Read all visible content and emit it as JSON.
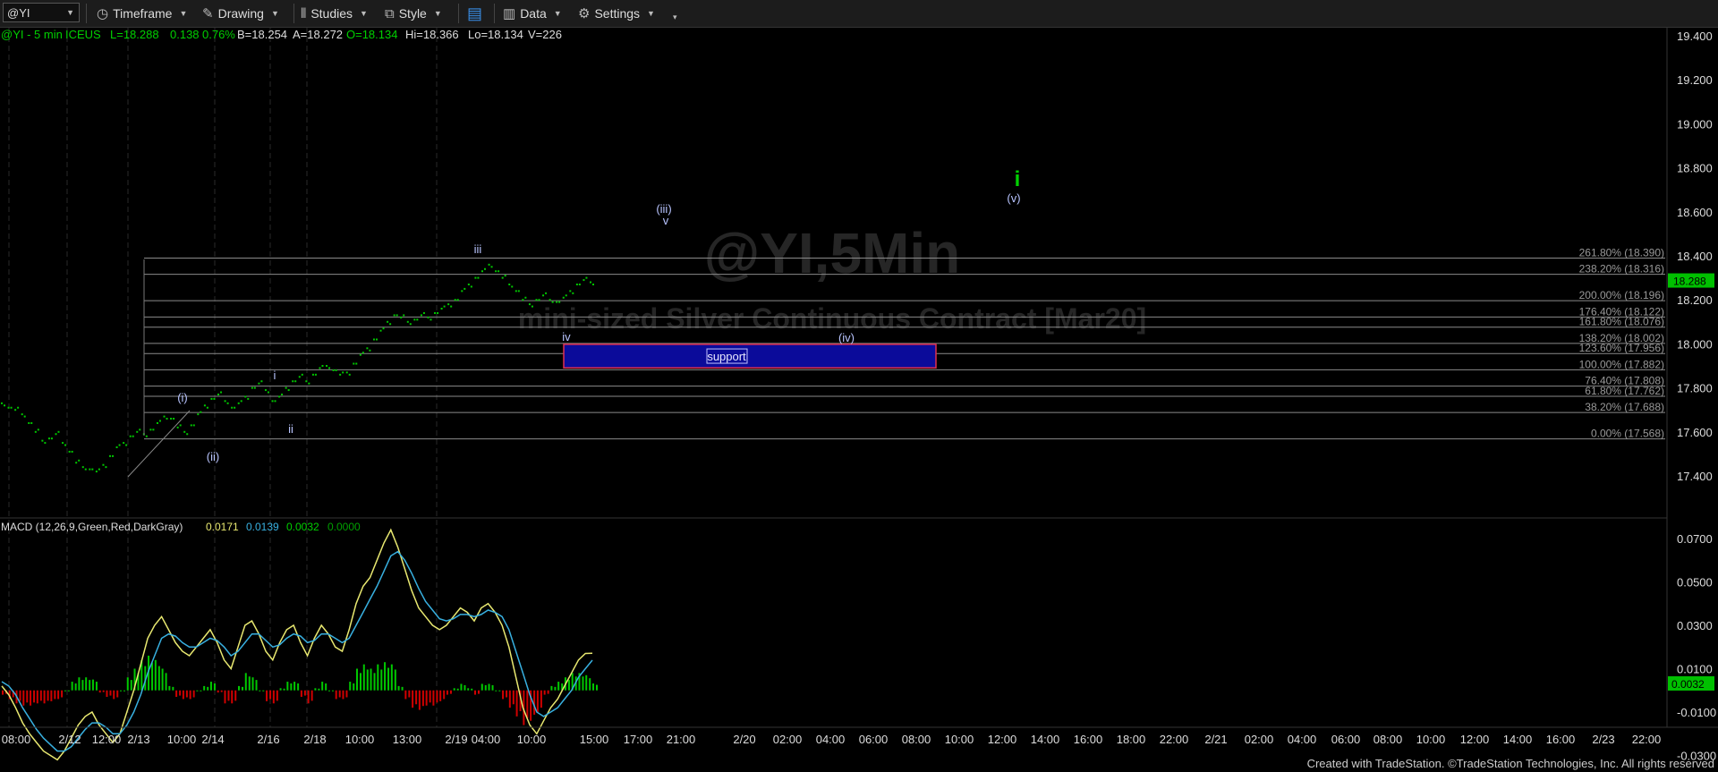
{
  "toolbar": {
    "symbol": "@YI",
    "items": [
      {
        "label": "Timeframe",
        "icon": "clock-icon"
      },
      {
        "label": "Drawing",
        "icon": "pencil-icon"
      },
      {
        "label": "Studies",
        "icon": "studies-icon"
      },
      {
        "label": "Style",
        "icon": "style-icon"
      },
      {
        "label": "",
        "icon": "layout-icon"
      },
      {
        "label": "Data",
        "icon": "data-icon"
      },
      {
        "label": "Settings",
        "icon": "gear-icon"
      }
    ]
  },
  "quote_line": {
    "symbol": "@YI - 5 min",
    "exchange": "ICEUS",
    "last": "L=18.288",
    "change": "0.138",
    "change_pct": "0.76%",
    "bid": "B=18.254",
    "ask": "A=18.272",
    "open": "O=18.134",
    "high": "Hi=18.366",
    "low": "Lo=18.134",
    "volume": "V=226"
  },
  "watermark": {
    "title": "@YI,5Min",
    "subtitle": "mini-sized Silver Continuous Contract [Mar20]"
  },
  "colors": {
    "up": "#00c800",
    "down": "#d00000",
    "macd_line": "#e8e870",
    "signal_line": "#38b0e0",
    "support_fill": "#0b0b9a",
    "support_border": "#e03050",
    "price_badge": "#00c000",
    "wave_green": "#00d000"
  },
  "chart_data": [
    {
      "type": "line",
      "title": "@YI - 5 min",
      "ylim": [
        17.27,
        19.46
      ],
      "y_ticks": [
        "19.400",
        "19.200",
        "19.000",
        "18.800",
        "18.600",
        "18.400",
        "18.200",
        "18.000",
        "17.800",
        "17.600",
        "17.400"
      ],
      "x_ticks": [
        "08:00",
        "2/12",
        "12:00",
        "2/13",
        "10:00",
        "2/14",
        "2/16",
        "2/18",
        "10:00",
        "13:00",
        "2/19",
        "04:00",
        "10:00",
        "15:00",
        "17:00",
        "21:00",
        "2/20",
        "02:00",
        "04:00",
        "06:00",
        "08:00",
        "10:00",
        "12:00",
        "14:00",
        "16:00",
        "18:00",
        "22:00",
        "2/21",
        "02:00",
        "04:00",
        "06:00",
        "08:00",
        "10:00",
        "12:00",
        "14:00",
        "16:00",
        "2/23",
        "22:00"
      ],
      "last_price": "18.288",
      "series": [
        {
          "values": [
            17.73,
            17.71,
            17.7,
            17.68,
            17.64,
            17.6,
            17.56,
            17.57,
            17.59,
            17.55,
            17.51,
            17.46,
            17.44,
            17.43,
            17.42,
            17.45,
            17.49,
            17.53,
            17.55,
            17.58,
            17.6,
            17.59,
            17.61,
            17.64,
            17.67,
            17.66,
            17.62,
            17.6,
            17.63,
            17.68,
            17.72,
            17.75,
            17.77,
            17.74,
            17.71,
            17.73,
            17.76,
            17.8,
            17.82,
            17.79,
            17.74,
            17.76,
            17.8,
            17.83,
            17.85,
            17.83,
            17.86,
            17.89,
            17.9,
            17.88,
            17.86,
            17.87,
            17.91,
            17.95,
            17.98,
            18.02,
            18.06,
            18.1,
            18.13,
            18.12,
            18.1,
            18.11,
            18.13,
            18.12,
            18.14,
            18.16,
            18.18,
            18.2,
            18.24,
            18.27,
            18.3,
            18.33,
            18.36,
            18.33,
            18.3,
            18.27,
            18.24,
            18.2,
            18.18,
            18.2,
            18.22,
            18.2,
            18.19,
            18.21,
            18.24,
            18.27,
            18.29,
            18.28
          ]
        }
      ],
      "fibonacci": [
        {
          "label": "261.80% (18.390)",
          "y": 18.39
        },
        {
          "label": "238.20% (18.316)",
          "y": 18.316
        },
        {
          "label": "200.00% (18.196)",
          "y": 18.196
        },
        {
          "label": "176.40% (18.122)",
          "y": 18.122
        },
        {
          "label": "161.80% (18.076)",
          "y": 18.076
        },
        {
          "label": "138.20% (18.002)",
          "y": 18.002
        },
        {
          "label": "123.60% (17.956)",
          "y": 17.956
        },
        {
          "label": "100.00% (17.882)",
          "y": 17.882
        },
        {
          "label": "76.40% (17.808)",
          "y": 17.808
        },
        {
          "label": "61.80% (17.762)",
          "y": 17.762
        },
        {
          "label": "38.20% (17.688)",
          "y": 17.688
        },
        {
          "label": "0.00% (17.568)",
          "y": 17.568
        }
      ],
      "support_box": {
        "label": "support",
        "y_top": 17.998,
        "y_bottom": 17.891
      },
      "wave_labels": [
        "(i)",
        "(ii)",
        "i",
        "ii",
        "iii",
        "iv",
        "(iii)",
        "v",
        "(iv)",
        "(v)",
        "i"
      ]
    },
    {
      "type": "line",
      "title": "MACD (12,26,9,Green,Red,DarkGray)",
      "readout": [
        "0.0171",
        "0.0139",
        "0.0032",
        "0.0000"
      ],
      "ylim": [
        -0.036,
        0.078
      ],
      "y_ticks": [
        "0.0700",
        "0.0500",
        "0.0300",
        "0.0100",
        "-0.0100",
        "-0.0300"
      ],
      "last_value": "0.0032",
      "series": [
        {
          "name": "MACD",
          "values": [
            0.002,
            -0.002,
            -0.008,
            -0.015,
            -0.02,
            -0.024,
            -0.028,
            -0.03,
            -0.032,
            -0.028,
            -0.022,
            -0.016,
            -0.012,
            -0.01,
            -0.016,
            -0.02,
            -0.024,
            -0.02,
            -0.01,
            0.0,
            0.012,
            0.024,
            0.03,
            0.034,
            0.028,
            0.022,
            0.018,
            0.016,
            0.02,
            0.024,
            0.028,
            0.022,
            0.014,
            0.01,
            0.02,
            0.03,
            0.032,
            0.026,
            0.018,
            0.014,
            0.022,
            0.028,
            0.03,
            0.022,
            0.016,
            0.024,
            0.03,
            0.026,
            0.02,
            0.018,
            0.028,
            0.04,
            0.048,
            0.052,
            0.06,
            0.068,
            0.074,
            0.066,
            0.056,
            0.046,
            0.038,
            0.034,
            0.03,
            0.028,
            0.03,
            0.034,
            0.038,
            0.036,
            0.032,
            0.038,
            0.04,
            0.036,
            0.03,
            0.02,
            0.006,
            -0.008,
            -0.016,
            -0.02,
            -0.014,
            -0.008,
            -0.004,
            0.002,
            0.008,
            0.014,
            0.017,
            0.0171
          ]
        },
        {
          "name": "Signal",
          "values": [
            0.004,
            0.002,
            -0.002,
            -0.008,
            -0.013,
            -0.018,
            -0.022,
            -0.025,
            -0.028,
            -0.028,
            -0.026,
            -0.022,
            -0.018,
            -0.015,
            -0.015,
            -0.017,
            -0.02,
            -0.02,
            -0.016,
            -0.01,
            -0.002,
            0.008,
            0.016,
            0.024,
            0.026,
            0.025,
            0.022,
            0.02,
            0.02,
            0.022,
            0.024,
            0.023,
            0.02,
            0.016,
            0.018,
            0.022,
            0.026,
            0.026,
            0.023,
            0.02,
            0.021,
            0.024,
            0.026,
            0.025,
            0.022,
            0.023,
            0.026,
            0.026,
            0.024,
            0.022,
            0.024,
            0.03,
            0.036,
            0.042,
            0.048,
            0.055,
            0.062,
            0.064,
            0.06,
            0.054,
            0.047,
            0.041,
            0.037,
            0.033,
            0.032,
            0.033,
            0.035,
            0.035,
            0.034,
            0.035,
            0.037,
            0.036,
            0.034,
            0.028,
            0.018,
            0.008,
            -0.002,
            -0.01,
            -0.012,
            -0.01,
            -0.008,
            -0.004,
            0.0,
            0.006,
            0.01,
            0.0139
          ]
        },
        {
          "name": "Histogram",
          "values": [
            -0.002,
            -0.004,
            -0.006,
            -0.007,
            -0.007,
            -0.006,
            -0.006,
            -0.005,
            -0.004,
            0.0,
            0.004,
            0.006,
            0.006,
            0.005,
            -0.001,
            -0.003,
            -0.004,
            0.0,
            0.006,
            0.01,
            0.014,
            0.016,
            0.014,
            0.01,
            0.002,
            -0.003,
            -0.004,
            -0.004,
            0.0,
            0.002,
            0.004,
            -0.001,
            -0.006,
            -0.006,
            0.002,
            0.008,
            0.006,
            0.0,
            -0.005,
            -0.006,
            0.001,
            0.004,
            0.004,
            -0.003,
            -0.006,
            0.001,
            0.004,
            0.0,
            -0.004,
            -0.004,
            0.004,
            0.01,
            0.012,
            0.01,
            0.012,
            0.013,
            0.012,
            0.002,
            -0.004,
            -0.008,
            -0.009,
            -0.007,
            -0.007,
            -0.005,
            -0.002,
            0.001,
            0.003,
            0.001,
            -0.002,
            0.003,
            0.003,
            0.0,
            -0.004,
            -0.008,
            -0.012,
            -0.016,
            -0.014,
            -0.01,
            -0.002,
            0.002,
            0.004,
            0.006,
            0.008,
            0.008,
            0.007,
            0.0032
          ]
        }
      ]
    }
  ],
  "footer": {
    "credit": "Created with TradeStation. ©TradeStation Technologies, Inc. All rights reserved"
  }
}
